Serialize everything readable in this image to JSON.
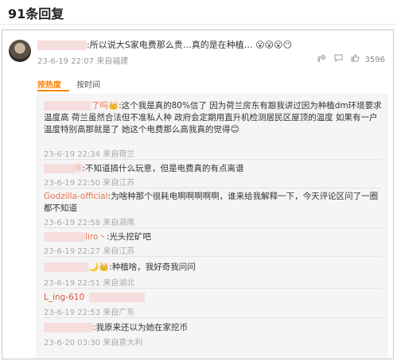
{
  "page_title": "91条回复",
  "main_comment": {
    "text": ":所以说大S家电费那么贵…真的是在种植…",
    "emojis": [
      "😮",
      "😮",
      "😮",
      "😶"
    ],
    "meta": "23-6-19 22:07 来自福建",
    "like_count": "3596"
  },
  "sort": {
    "hot": "按热度",
    "time": "按时间"
  },
  "replies": [
    {
      "user": "了吗",
      "text": ":这个我是真的80%信了 因为荷兰房东有跟我讲过因为种植dm环境要求温度高 荷兰虽然合法但不准私人种 政府会定期用直升机检测居民区屋顶的温度 如果有一户温度特别高那就是了 她这个电费那么高我真的觉得",
      "meta": "23-6-19 22:34 来自荷兰"
    },
    {
      "user": "作",
      "text": ":不知道搞什么玩意，但是电费真的有点离谱",
      "meta": "23-6-19 22:50 来自江苏"
    },
    {
      "user": "Godzilla-official",
      "text": ":为啥种那个很耗电啊啊啊啊啊，谁来给我解释一下，今天评论区问了一圈都不知道",
      "meta": "23-6-19 22:58 来自湖南"
    },
    {
      "user": "liro丶",
      "text": ":光头挖矿吧",
      "meta": "23-6-19 22:27 来自江苏"
    },
    {
      "user": "",
      "text": ":种植啥，我好奇我问问",
      "meta": "23-6-19 22:51 来自湖北"
    },
    {
      "user": "L_ing-610",
      "text": "",
      "meta": "23-6-19 22:53 来自广东"
    },
    {
      "user": "",
      "text": ":我原来还以为她在家挖币",
      "meta": "23-6-20 03:30 来自意大利"
    }
  ]
}
